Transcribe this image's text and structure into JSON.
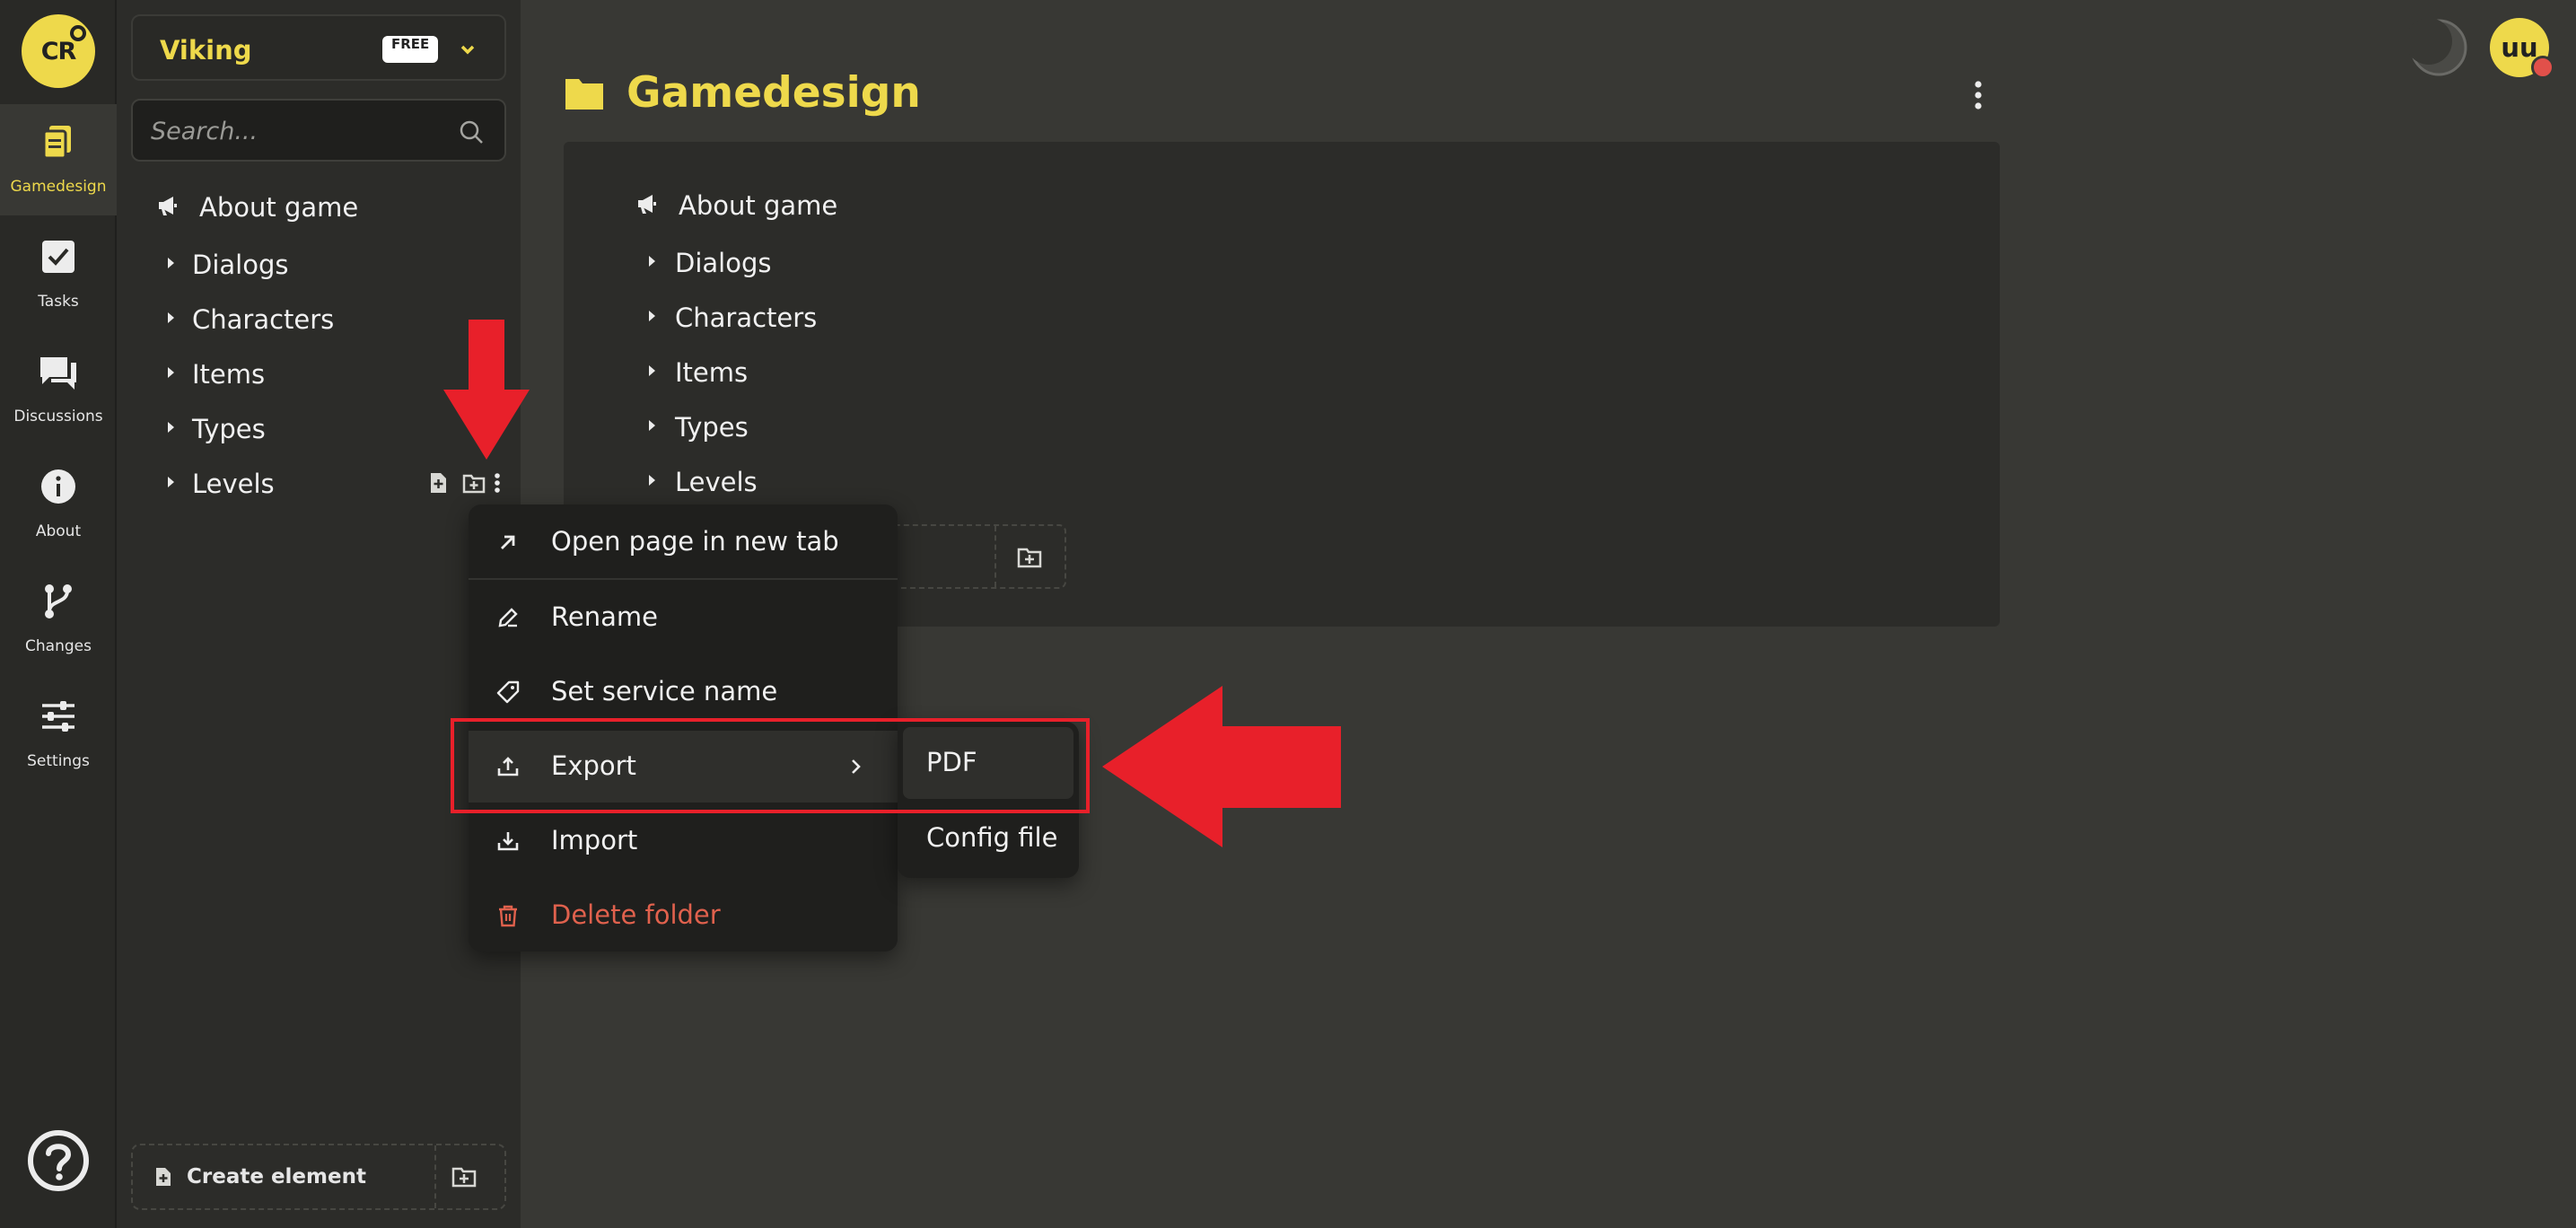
{
  "app": {
    "logo_text": "CR",
    "colors": {
      "accent": "#eed94b",
      "danger": "#e0614d",
      "annotation": "#e8202a"
    }
  },
  "rail": {
    "items": [
      {
        "label": "Gamedesign",
        "icon": "pages-icon",
        "active": true
      },
      {
        "label": "Tasks",
        "icon": "checkbox-icon"
      },
      {
        "label": "Discussions",
        "icon": "chat-icon"
      },
      {
        "label": "About",
        "icon": "info-icon"
      },
      {
        "label": "Changes",
        "icon": "branch-icon"
      },
      {
        "label": "Settings",
        "icon": "sliders-icon"
      }
    ],
    "help_icon": "help-icon"
  },
  "sidebar": {
    "project_name": "Viking",
    "plan_badge": "FREE",
    "search_placeholder": "Search...",
    "tree": [
      {
        "label": "About game",
        "icon": "megaphone-icon"
      },
      {
        "label": "Dialogs",
        "icon": "caret-right-icon"
      },
      {
        "label": "Characters",
        "icon": "caret-right-icon"
      },
      {
        "label": "Items",
        "icon": "caret-right-icon"
      },
      {
        "label": "Types",
        "icon": "caret-right-icon"
      },
      {
        "label": "Levels",
        "icon": "caret-right-icon"
      }
    ],
    "create_element_label": "Create element"
  },
  "main": {
    "title": "Gamedesign",
    "tree": [
      {
        "label": "About game"
      },
      {
        "label": "Dialogs"
      },
      {
        "label": "Characters"
      },
      {
        "label": "Items"
      },
      {
        "label": "Types"
      },
      {
        "label": "Levels"
      }
    ]
  },
  "user": {
    "initials": "uu"
  },
  "context_menu": {
    "items": [
      {
        "label": "Open page in new tab",
        "icon": "arrow-up-right-icon"
      },
      {
        "label": "Rename",
        "icon": "pencil-icon"
      },
      {
        "label": "Set service name",
        "icon": "tag-icon"
      },
      {
        "label": "Export",
        "icon": "upload-icon",
        "has_submenu": true
      },
      {
        "label": "Import",
        "icon": "download-icon"
      },
      {
        "label": "Delete folder",
        "icon": "trash-icon",
        "danger": true
      }
    ],
    "submenu": [
      {
        "label": "PDF"
      },
      {
        "label": "Config file"
      }
    ]
  }
}
